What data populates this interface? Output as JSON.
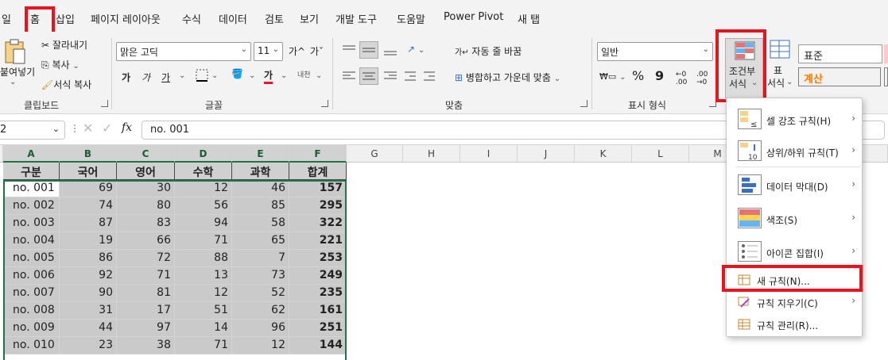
{
  "tabs": [
    "일",
    "홈",
    "삽입",
    "페이지 레이아웃",
    "수식",
    "데이터",
    "검토",
    "보기",
    "개발 도구",
    "도움말",
    "Power Pivot",
    "새 탭"
  ],
  "clipboard": {
    "paste": "붙여넣기",
    "cut": "잘라내기",
    "copy": "복사",
    "format_painter": "서식 복사",
    "group": "클립보드"
  },
  "font": {
    "name": "맑은 고딕",
    "size": "11",
    "grow": "가^",
    "shrink": "가ˇ",
    "bold": "가",
    "italic": "가",
    "underline": "가",
    "color_label": "가",
    "phonetic": "내천",
    "group": "글꼴"
  },
  "alignment": {
    "wrap": "자동 줄 바꿈",
    "merge": "병합하고 가운데 맞춤",
    "group": "맞춤"
  },
  "number": {
    "format": "일반",
    "percent": "%",
    "comma": "9",
    "group": "표시 형식"
  },
  "styles": {
    "cond_format_line1": "조건부",
    "cond_format_line2": "서식",
    "table_line1": "표",
    "table_line2": "서식",
    "normal": "표준",
    "calc": "계산"
  },
  "formula": {
    "value": "no. 001",
    "fx": "fx"
  },
  "columns": [
    "A",
    "B",
    "C",
    "D",
    "E",
    "F",
    "G",
    "H",
    "I",
    "J",
    "K",
    "L",
    "M"
  ],
  "table": {
    "headers": [
      "구분",
      "국어",
      "영어",
      "수학",
      "과학",
      "합계"
    ],
    "rows": [
      [
        "no. 001",
        "69",
        "30",
        "12",
        "46",
        "157"
      ],
      [
        "no. 002",
        "74",
        "80",
        "56",
        "85",
        "295"
      ],
      [
        "no. 003",
        "87",
        "83",
        "94",
        "58",
        "322"
      ],
      [
        "no. 004",
        "19",
        "66",
        "71",
        "65",
        "221"
      ],
      [
        "no. 005",
        "86",
        "72",
        "88",
        "7",
        "253"
      ],
      [
        "no. 006",
        "92",
        "71",
        "13",
        "73",
        "249"
      ],
      [
        "no. 007",
        "90",
        "81",
        "12",
        "52",
        "235"
      ],
      [
        "no. 008",
        "31",
        "17",
        "51",
        "62",
        "161"
      ],
      [
        "no. 009",
        "44",
        "97",
        "14",
        "96",
        "251"
      ],
      [
        "no. 010",
        "23",
        "38",
        "71",
        "12",
        "144"
      ]
    ]
  },
  "cf_menu": {
    "items": [
      {
        "label": "셀 강조 규칙(H)",
        "icon": "highlight-rules-icon",
        "submenu": true
      },
      {
        "label": "상위/하위 규칙(T)",
        "icon": "top-bottom-rules-icon",
        "submenu": true
      },
      {
        "label": "데이터 막대(D)",
        "icon": "data-bars-icon",
        "submenu": true
      },
      {
        "label": "색조(S)",
        "icon": "color-scales-icon",
        "submenu": true
      },
      {
        "label": "아이콘 집합(I)",
        "icon": "icon-sets-icon",
        "submenu": true
      }
    ],
    "new_rule": "새 규칙(N)...",
    "clear_rules": "규칙 지우기(C)",
    "manage_rules": "규칙 관리(R)..."
  },
  "colors": {
    "highlight": "#e5141e",
    "excel_green": "#217346",
    "header_gray": "#d0d0d0",
    "cell_gray": "#cacaca"
  }
}
